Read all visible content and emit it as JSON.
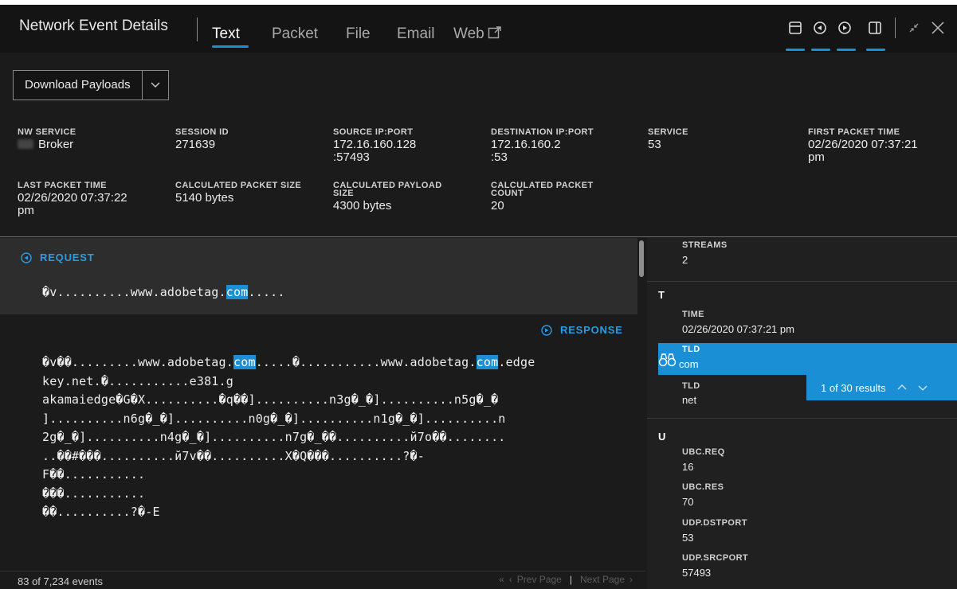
{
  "header": {
    "title": "Network Event Details",
    "tabs": [
      {
        "label": "Text",
        "active": true
      },
      {
        "label": "Packet",
        "active": false
      },
      {
        "label": "File",
        "active": false
      },
      {
        "label": "Email",
        "active": false
      },
      {
        "label": "Web",
        "active": false
      }
    ],
    "window_buttons": [
      "layout-icon",
      "request-icon",
      "response-icon",
      "split-pane-icon",
      "shrink-icon",
      "close-icon"
    ]
  },
  "toolbar": {
    "download_label": "Download Payloads"
  },
  "meta": {
    "nw_service": {
      "label": "NW SERVICE",
      "value": "Broker"
    },
    "session_id": {
      "label": "SESSION ID",
      "value": "271639"
    },
    "source_ip": {
      "label": "SOURCE IP:PORT",
      "value_line1": "172.16.160.128",
      "value_line2": ":57493"
    },
    "dest_ip": {
      "label": "DESTINATION IP:PORT",
      "value_line1": "172.16.160.2",
      "value_line2": ":53"
    },
    "service": {
      "label": "SERVICE",
      "value": "53"
    },
    "first_packet": {
      "label": "FIRST PACKET TIME",
      "value_line1": "02/26/2020 07:37:21",
      "value_line2": "pm"
    },
    "last_packet": {
      "label": "LAST PACKET TIME",
      "value_line1": "02/26/2020 07:37:22",
      "value_line2": "pm"
    },
    "calc_packet_size": {
      "label": "CALCULATED PACKET SIZE",
      "value": "5140 bytes"
    },
    "calc_payload_size": {
      "label_line1": "CALCULATED PAYLOAD",
      "label_line2": "SIZE",
      "value": "4300 bytes"
    },
    "calc_packet_count": {
      "label_line1": "CALCULATED PACKET",
      "label_line2": "COUNT",
      "value": "20"
    }
  },
  "text_pane": {
    "request_label": "REQUEST",
    "request_pre": "�v..........www.adobetag.",
    "request_hl": "com",
    "request_post": ".....",
    "response_label": "RESPONSE",
    "response_line1_a": "�v��.........www.adobetag.",
    "response_line1_hl1": "com",
    "response_line1_b": ".....�...........www.adobetag.",
    "response_line1_hl2": "com",
    "response_line1_c": ".edge",
    "response_lines": [
      "key.net.�...........e381.g",
      "akamaiedge�G�X..........�q��]..........n3g�_�]..........n5g�_�",
      "]..........n6g�_�]..........n0g�_�]..........n1g�_�]..........n",
      "2g�_�]..........n4g�_�]..........n7g�_��..........й7o��........",
      "..��#���..........й7v��..........X�Q���..........?�-",
      "F��...........",
      "���...........",
      "��..........?�-E"
    ],
    "events_count": "83 of 7,234 events",
    "prev_page": "Prev Page",
    "next_page": "Next Page"
  },
  "meta_pane": {
    "streams_key": "STREAMS",
    "streams_val": "2",
    "t_letter": "T",
    "time_key": "TIME",
    "time_val": "02/26/2020 07:37:21 pm",
    "tld1_key": "TLD",
    "tld1_val": "com",
    "tld2_key": "TLD",
    "tld2_val": "net",
    "results_text": "1 of 30 results",
    "u_letter": "U",
    "ubc_req_key": "UBC.REQ",
    "ubc_req_val": "16",
    "ubc_res_key": "UBC.RES",
    "ubc_res_val": "70",
    "udp_dst_key": "UDP.DSTPORT",
    "udp_dst_val": "53",
    "udp_src_key": "UDP.SRCPORT",
    "udp_src_val": "57493"
  },
  "colors": {
    "accent": "#1a8fd6",
    "background": "#1b1b1b",
    "header": "#141414"
  }
}
